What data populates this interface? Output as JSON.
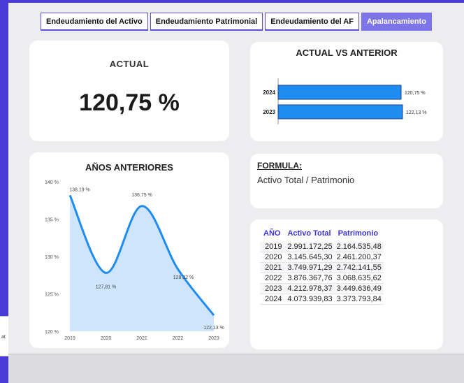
{
  "tabs": [
    {
      "label": "Endeudamiento del Activo",
      "active": false
    },
    {
      "label": "Endeudamiento Patrimonial",
      "active": false
    },
    {
      "label": "Endeudamiento del AF",
      "active": false
    },
    {
      "label": "Apalancamiento",
      "active": true
    }
  ],
  "actual": {
    "label": "ACTUAL",
    "value": "120,75 %"
  },
  "comparison": {
    "title": "ACTUAL VS ANTERIOR",
    "bar_color": "#1e8cf0"
  },
  "history": {
    "title": "AÑOS ANTERIORES"
  },
  "formula": {
    "title": "FORMULA:",
    "text": "Activo Total / Patrimonio"
  },
  "table": {
    "headers": [
      "AÑO",
      "Activo Total",
      "Patrimonio"
    ],
    "rows": [
      [
        "2019",
        "2.991.172,25",
        "2.164.535,48"
      ],
      [
        "2020",
        "3.145.645,30",
        "2.461.200,37"
      ],
      [
        "2021",
        "3.749.971,29",
        "2.742.141,55"
      ],
      [
        "2022",
        "3.876.367,76",
        "3.068.635,62"
      ],
      [
        "2023",
        "4.212.978,37",
        "3.449.636,49"
      ],
      [
        "2024",
        "4.073.939,83",
        "3.373.793,84"
      ]
    ]
  },
  "left_stub_text": "at",
  "chart_data": [
    {
      "type": "bar",
      "title": "ACTUAL VS ANTERIOR",
      "orientation": "horizontal",
      "categories": [
        "2024",
        "2023"
      ],
      "values": [
        120.75,
        122.13
      ],
      "data_labels": [
        "120,75 %",
        "122,13 %"
      ]
    },
    {
      "type": "area",
      "title": "AÑOS ANTERIORES",
      "x": [
        "2019",
        "2020",
        "2021",
        "2022",
        "2023"
      ],
      "values": [
        138.19,
        127.81,
        136.75,
        128.32,
        122.13
      ],
      "data_labels": [
        "138,19 %",
        "127,81 %",
        "136,75 %",
        "128,32 %",
        "122,13 %"
      ],
      "ylim": [
        120,
        140
      ],
      "yticks": [
        "140 %",
        "135 %",
        "130 %",
        "125 %",
        "120 %"
      ],
      "ytick_values": [
        140,
        135,
        130,
        125,
        120
      ],
      "fill_color": "#cfe5fb",
      "line_color": "#1e8cf0"
    }
  ]
}
